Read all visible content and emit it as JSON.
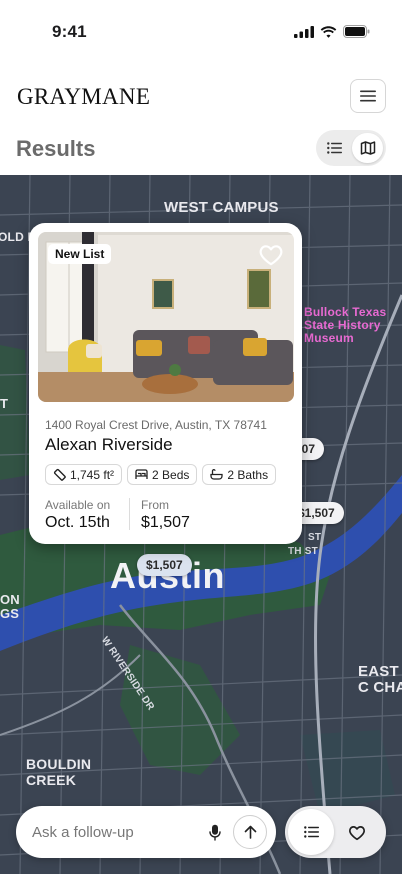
{
  "status_bar": {
    "time": "9:41"
  },
  "header": {
    "brand": "GRAYMANE"
  },
  "results": {
    "title": "Results"
  },
  "map": {
    "labels": {
      "west_campus": "WEST CAMPUS",
      "old_e": "OLD E",
      "museum": "Bullock Texas State History Museum",
      "city": "Austin",
      "riverside": "W RIVERSIDE DR",
      "st_1": "ST",
      "st_2": "TH ST",
      "on_gs": "ON GS",
      "east_cha": "EAST C CHA",
      "bouldin": "BOULDIN CREEK",
      "t_edge": "T"
    },
    "pins": [
      "507",
      "$1,507",
      "$1,507"
    ]
  },
  "listing": {
    "badge": "New List",
    "address": "1400 Royal Crest Drive, Austin, TX 78741",
    "name": "Alexan Riverside",
    "sqft": "1,745 ft²",
    "beds": "2 Beds",
    "baths": "2 Baths",
    "available_label": "Available on",
    "available_value": "Oct. 15th",
    "price_label": "From",
    "price_value": "$1,507"
  },
  "chat": {
    "placeholder": "Ask a follow-up"
  },
  "icons": [
    "signal-icon",
    "wifi-icon",
    "battery-icon",
    "menu-icon",
    "list-icon",
    "map-icon",
    "heart-icon",
    "ruler-icon",
    "bed-icon",
    "bath-icon",
    "mic-icon",
    "arrow-up-icon"
  ],
  "colors": {
    "map_bg": "#3b4452",
    "park": "#2f5a3e",
    "river": "#2e4fae",
    "museum_label": "#e86ad2"
  }
}
